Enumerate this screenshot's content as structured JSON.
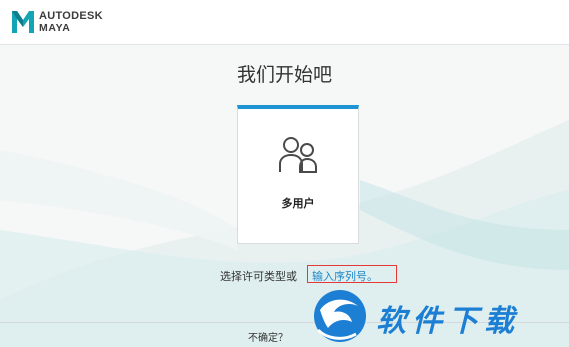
{
  "header": {
    "brand": "AUTODESK",
    "product": "MAYA",
    "logo_letter": "M"
  },
  "main": {
    "title": "我们开始吧",
    "card": {
      "label": "多用户",
      "icon": "users-icon",
      "accent": "#1e94d2"
    },
    "license_prompt": "选择许可类型或",
    "serial_link": "输入序列号。"
  },
  "footer": {
    "unsure_label": "不确定？"
  },
  "watermark": {
    "text": "软件下载",
    "icon": "dragon-logo-icon",
    "color": "#1c7fd3"
  }
}
